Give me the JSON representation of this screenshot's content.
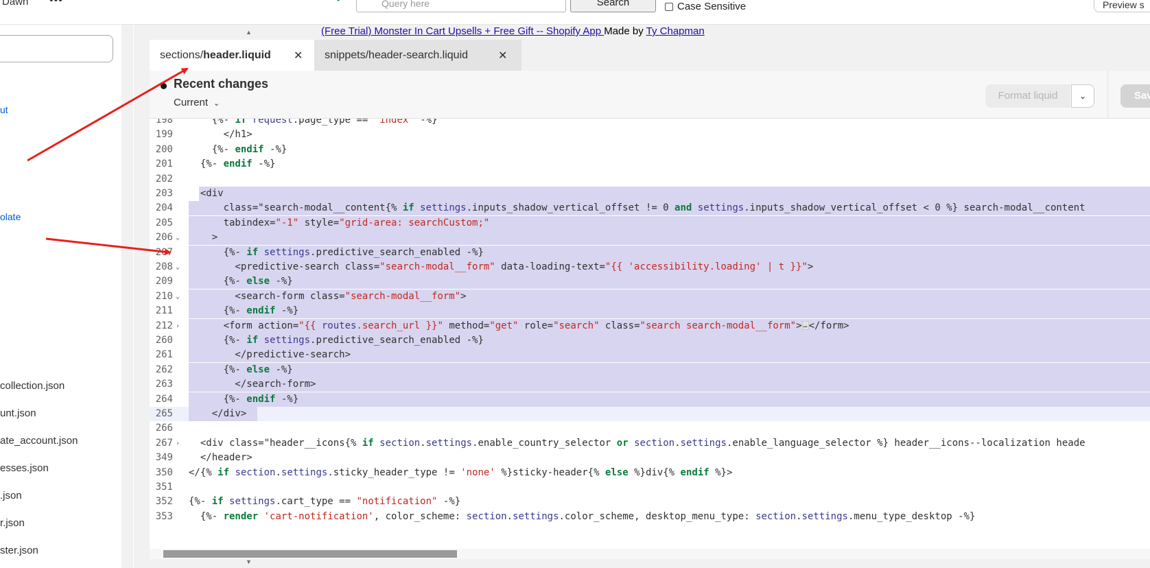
{
  "topbar": {
    "store_name": "Dawn",
    "more": "•••",
    "query_placeholder": "Query here",
    "search_label": "Search",
    "case_sensitive_label": "Case Sensitive",
    "preview_label": "Preview s"
  },
  "sidebar": {
    "links": [
      "ut",
      "olate"
    ],
    "files": [
      "collection.json",
      "unt.json",
      "ate_account.json",
      "esses.json",
      ".json",
      "r.json",
      "ster.json"
    ]
  },
  "app_link": {
    "link_text": "(Free Trial) Monster In Cart Upsells + Free Gift -- Shopify App ",
    "made_by": "Made by ",
    "author": "Ty Chapman"
  },
  "tabs": [
    {
      "prefix": "sections/",
      "name": "header.liquid"
    },
    {
      "prefix": "",
      "name": "snippets/header-search.liquid"
    }
  ],
  "toolbar": {
    "title": "Recent changes",
    "version": "Current",
    "format_label": "Format liquid",
    "save_label": "Sav"
  },
  "code_lines": [
    {
      "n": "198",
      "text": "    {%- if request.page_type == 'index' -%}"
    },
    {
      "n": "199",
      "text": "      </h1>"
    },
    {
      "n": "200",
      "text": "    {%- endif -%}"
    },
    {
      "n": "201",
      "text": "  {%- endif -%}"
    },
    {
      "n": "202",
      "text": ""
    },
    {
      "n": "203",
      "text": "  <div"
    },
    {
      "n": "204",
      "text": "      class=\"search-modal__content{% if settings.inputs_shadow_vertical_offset != 0 and settings.inputs_shadow_vertical_offset < 0 %} search-modal__content"
    },
    {
      "n": "205",
      "text": "      tabindex=\"-1\" style=\"grid-area: searchCustom;\""
    },
    {
      "n": "206",
      "text": "    >"
    },
    {
      "n": "207",
      "text": "      {%- if settings.predictive_search_enabled -%}"
    },
    {
      "n": "208",
      "text": "        <predictive-search class=\"search-modal__form\" data-loading-text=\"{{ 'accessibility.loading' | t }}\">"
    },
    {
      "n": "209",
      "text": "      {%- else -%}"
    },
    {
      "n": "210",
      "text": "        <search-form class=\"search-modal__form\">"
    },
    {
      "n": "211",
      "text": "      {%- endif -%}"
    },
    {
      "n": "212",
      "text": "      <form action=\"{{ routes.search_url }}\" method=\"get\" role=\"search\" class=\"search search-modal__form\">…</form>"
    },
    {
      "n": "260",
      "text": "      {%- if settings.predictive_search_enabled -%}"
    },
    {
      "n": "261",
      "text": "        </predictive-search>"
    },
    {
      "n": "262",
      "text": "      {%- else -%}"
    },
    {
      "n": "263",
      "text": "        </search-form>"
    },
    {
      "n": "264",
      "text": "      {%- endif -%}"
    },
    {
      "n": "265",
      "text": "    </div>"
    },
    {
      "n": "266",
      "text": ""
    },
    {
      "n": "267",
      "text": "  <div class=\"header__icons{% if section.settings.enable_country_selector or section.settings.enable_language_selector %} header__icons--localization heade"
    },
    {
      "n": "349",
      "text": "  </header>"
    },
    {
      "n": "350",
      "text": "</{% if section.settings.sticky_header_type != 'none' %}sticky-header{% else %}div{% endif %}>"
    },
    {
      "n": "351",
      "text": ""
    },
    {
      "n": "352",
      "text": "{%- if settings.cart_type == \"notification\" -%}"
    },
    {
      "n": "353",
      "text": "  {%- render 'cart-notification', color_scheme: section.settings.color_scheme, desktop_menu_type: section.settings.menu_type_desktop -%}"
    }
  ],
  "colors": {
    "keyword": "#0b7a3e",
    "string": "#c2271f",
    "variable": "#3a3a8f",
    "selection": "#d8d5f0",
    "annotation_arrow": "#e8201b"
  }
}
